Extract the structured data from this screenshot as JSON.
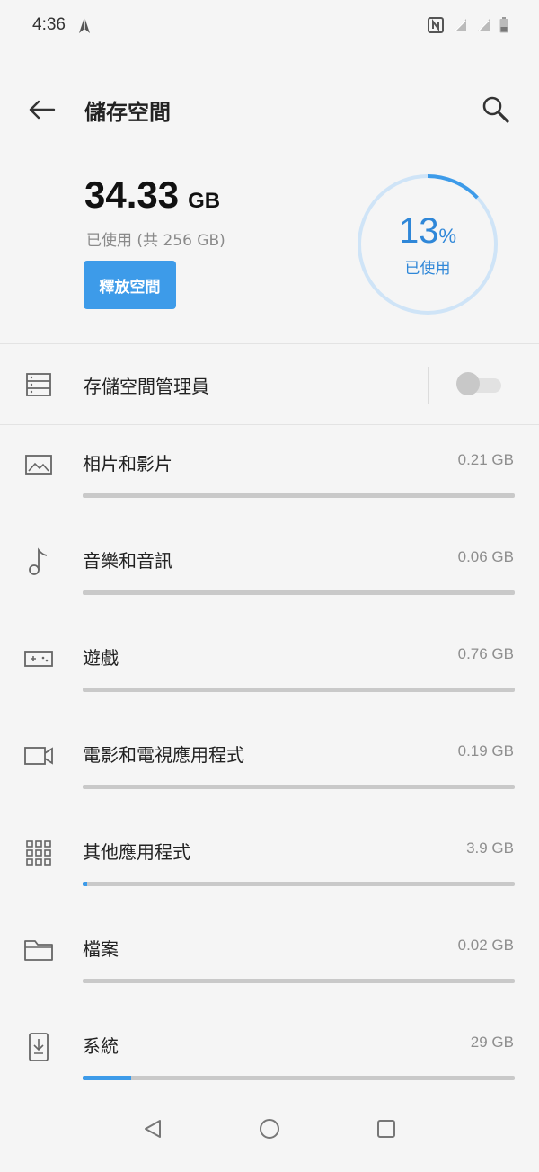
{
  "status_bar": {
    "time": "4:36"
  },
  "header": {
    "title": "儲存空間",
    "back_icon": "arrow-left-icon",
    "search_icon": "search-icon"
  },
  "summary": {
    "used_value": "34.33",
    "used_unit": "GB",
    "total_text": "已使用 (共 256 GB)",
    "free_button": "釋放空間",
    "percent_value": "13",
    "percent_sign": "%",
    "percent_label": "已使用",
    "percent_fraction": 0.13,
    "accent": "#3d9be9"
  },
  "manager": {
    "label": "存儲空間管理員",
    "toggle_on": false
  },
  "categories": [
    {
      "label": "相片和影片",
      "size": "0.21 GB",
      "fraction": 0.0,
      "icon": "image-icon"
    },
    {
      "label": "音樂和音訊",
      "size": "0.06 GB",
      "fraction": 0.0,
      "icon": "music-note-icon"
    },
    {
      "label": "遊戲",
      "size": "0.76 GB",
      "fraction": 0.0,
      "icon": "gamepad-icon"
    },
    {
      "label": "電影和電視應用程式",
      "size": "0.19 GB",
      "fraction": 0.0,
      "icon": "video-camera-icon"
    },
    {
      "label": "其他應用程式",
      "size": "3.9 GB",
      "fraction": 0.011,
      "icon": "apps-grid-icon"
    },
    {
      "label": "檔案",
      "size": "0.02 GB",
      "fraction": 0.0,
      "icon": "folder-icon"
    },
    {
      "label": "系統",
      "size": "29 GB",
      "fraction": 0.113,
      "icon": "system-download-icon"
    }
  ]
}
